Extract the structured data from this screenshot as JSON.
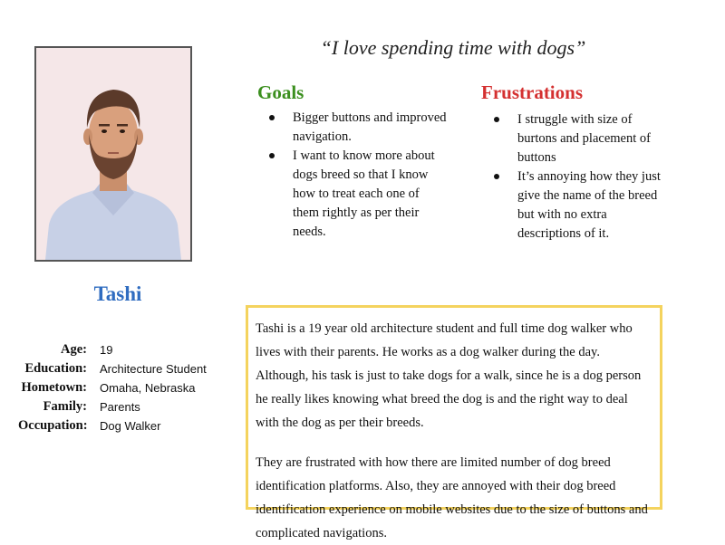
{
  "persona": {
    "quote": "“I love spending time with dogs”",
    "name": "Tashi",
    "photo_icon": "man-avatar-icon",
    "facts": [
      {
        "label": "Age:",
        "value": "19"
      },
      {
        "label": "Education:",
        "value": "Architecture Student"
      },
      {
        "label": "Hometown:",
        "value": "Omaha, Nebraska"
      },
      {
        "label": "Family:",
        "value": "Parents"
      },
      {
        "label": "Occupation:",
        "value": "Dog Walker"
      }
    ]
  },
  "goals": {
    "title": "Goals",
    "items": [
      "Bigger buttons and improved navigation.",
      "I want to know more about dogs breed so that I know how to treat each one of them rightly as per their needs."
    ]
  },
  "frustrations": {
    "title": "Frustrations",
    "items": [
      "I struggle with size of burtons and placement of buttons",
      "It’s annoying how they just give the name of the breed but with no extra descriptions of it."
    ]
  },
  "bio": {
    "paragraphs": [
      "Tashi is a 19 year old architecture student and full time dog walker who lives with their parents. He works as a dog walker during the day. Although, his task is just to take dogs for a walk, since he is a dog person he really likes knowing what breed the dog is and the right way to deal with the dog as per their breeds.",
      "They are frustrated with how there are limited number of dog breed identification platforms. Also, they are annoyed with their dog breed identification experience on mobile websites due to the size of buttons and complicated navigations."
    ]
  },
  "colors": {
    "goals": "#3b8f1e",
    "frustrations": "#d43030",
    "name": "#2f6cc0",
    "bio_border": "#f4d35e"
  }
}
